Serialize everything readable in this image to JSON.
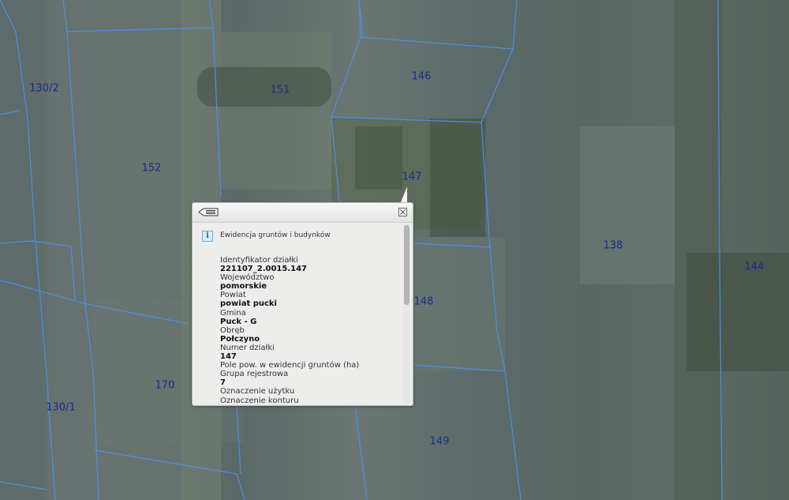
{
  "parcels": [
    {
      "id": "p130_2",
      "label": "130/2"
    },
    {
      "id": "p151",
      "label": "151"
    },
    {
      "id": "p146",
      "label": "146"
    },
    {
      "id": "p152",
      "label": "152"
    },
    {
      "id": "p147",
      "label": "147"
    },
    {
      "id": "p138",
      "label": "138"
    },
    {
      "id": "p144",
      "label": "144"
    },
    {
      "id": "p148",
      "label": "148"
    },
    {
      "id": "p170",
      "label": "170"
    },
    {
      "id": "p130_1",
      "label": "130/1"
    },
    {
      "id": "p149",
      "label": "149"
    }
  ],
  "popup": {
    "back_icon": "list-back-icon",
    "close_icon": "close-icon",
    "info_icon_glyph": "i",
    "layer_title": "Ewidencja gruntów i budynków",
    "fields": [
      {
        "label": "Identyfikator działki",
        "value": "221107_2.0015.147"
      },
      {
        "label": "Województwo",
        "value": "pomorskie"
      },
      {
        "label": "Powiat",
        "value": "powiat pucki"
      },
      {
        "label": "Gmina",
        "value": "Puck - G"
      },
      {
        "label": "Obręb",
        "value": "Połczyno"
      },
      {
        "label": "Numer działki",
        "value": "147"
      },
      {
        "label": "Pole pow. w ewidencji gruntów (ha)",
        "value": ""
      },
      {
        "label": "Grupa rejestrowa",
        "value": "7"
      },
      {
        "label": "Oznaczenie użytku",
        "value": ""
      },
      {
        "label": "Oznaczenie konturu",
        "value": ""
      }
    ]
  },
  "colors": {
    "parcel_line": "#4d8fe6",
    "parcel_label": "#1c2a8a"
  }
}
